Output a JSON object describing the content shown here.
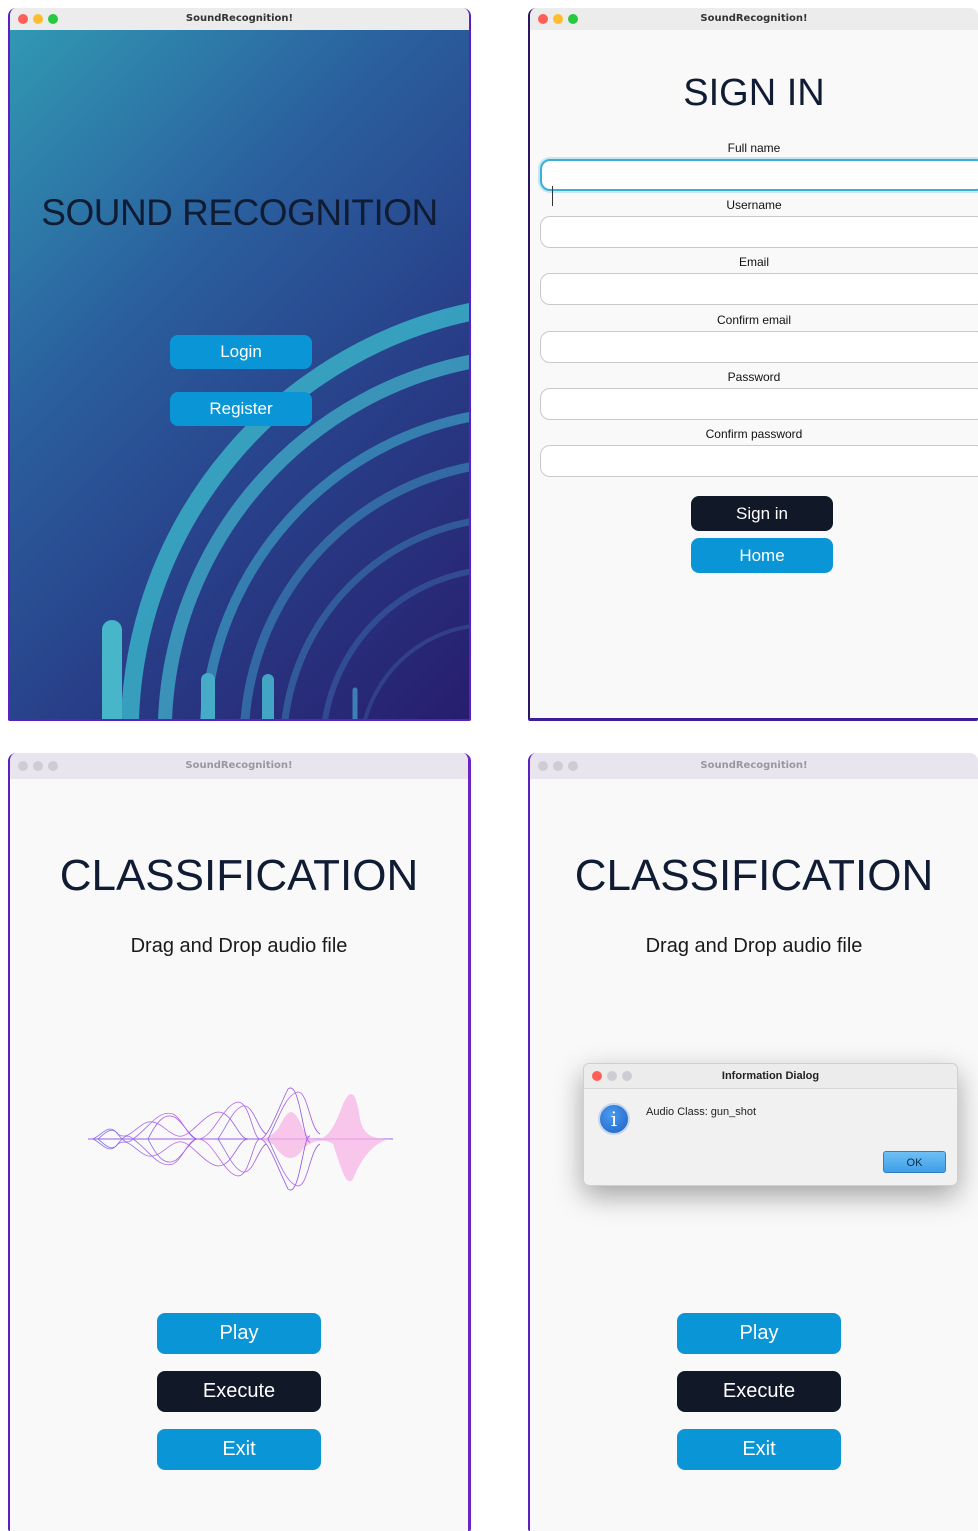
{
  "app_title": "SoundRecognition!",
  "welcome": {
    "heading": "SOUND RECOGNITION",
    "login_label": "Login",
    "register_label": "Register"
  },
  "signin": {
    "heading": "SIGN IN",
    "fields": [
      {
        "label": "Full name",
        "value": ""
      },
      {
        "label": "Username",
        "value": ""
      },
      {
        "label": "Email",
        "value": ""
      },
      {
        "label": "Confirm email",
        "value": ""
      },
      {
        "label": "Password",
        "value": ""
      },
      {
        "label": "Confirm password",
        "value": ""
      }
    ],
    "signin_label": "Sign in",
    "home_label": "Home"
  },
  "classification": {
    "heading": "CLASSIFICATION",
    "subtitle": "Drag and Drop audio file",
    "play_label": "Play",
    "execute_label": "Execute",
    "exit_label": "Exit"
  },
  "dialog": {
    "title": "Information Dialog",
    "message": "Audio Class: gun_shot",
    "ok_label": "OK",
    "icon": "info-icon"
  },
  "colors": {
    "accent_blue": "#0a96d6",
    "dark_button": "#111827",
    "heading_text": "#101c33",
    "window_border": "#5a21c0"
  }
}
